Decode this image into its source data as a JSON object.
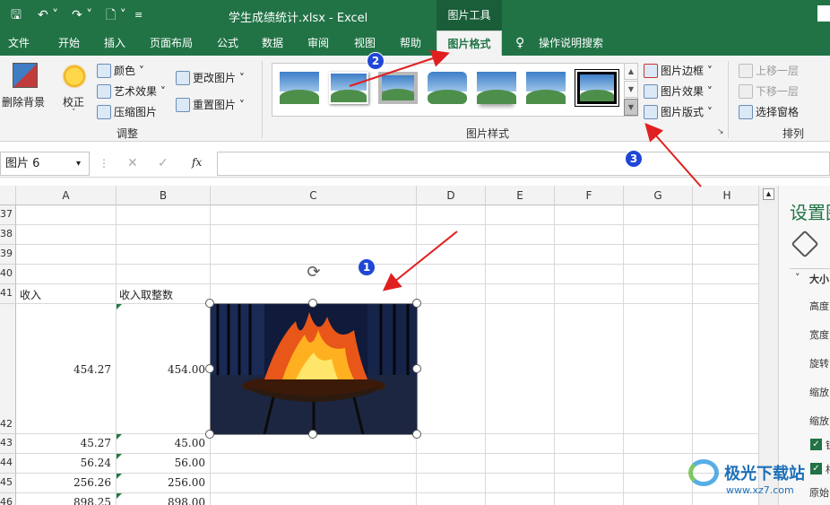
{
  "title_bar": {
    "doc_title": "学生成绩统计.xlsx  -  Excel",
    "context_tool": "图片工具",
    "qa_save": "🖫",
    "qa_undo": "↶ ˅",
    "qa_redo": "↷ ˅",
    "qa_preview": "🗋 ˅",
    "qa_more": "≡"
  },
  "menu": {
    "tabs": [
      "文件",
      "开始",
      "插入",
      "页面布局",
      "公式",
      "数据",
      "审阅",
      "视图",
      "帮助",
      "图片格式",
      "操作说明搜索"
    ],
    "active": "图片格式",
    "search_icon": "lightbulb-icon"
  },
  "ribbon": {
    "remove_bg": "删除背景",
    "corrections": "校正",
    "color": "颜色 ˅",
    "art_effects": "艺术效果 ˅",
    "compress": "压缩图片",
    "change_picture": "更改图片 ˅",
    "reset_picture": "重置图片 ˅",
    "group_adjust": "调整",
    "group_styles": "图片样式",
    "picture_border": "图片边框 ˅",
    "picture_effects": "图片效果 ˅",
    "picture_layout": "图片版式 ˅",
    "bring_forward": "上移一层",
    "send_backward": "下移一层",
    "selection_pane": "选择窗格",
    "group_arrange": "排列",
    "gallery_up": "▲",
    "gallery_down": "▼",
    "gallery_more": "▼",
    "launcher": "↘"
  },
  "formula_bar": {
    "name_box": "图片 6",
    "name_dropdown": "▾",
    "more": "⋮",
    "cancel": "✕",
    "enter": "✓",
    "fx": "fx",
    "value": ""
  },
  "columns": [
    "A",
    "B",
    "C",
    "D",
    "E",
    "F",
    "G",
    "H"
  ],
  "rows": [
    {
      "num": "37",
      "a": "",
      "b": ""
    },
    {
      "num": "38",
      "a": "",
      "b": ""
    },
    {
      "num": "39",
      "a": "",
      "b": ""
    },
    {
      "num": "40",
      "a": "",
      "b": ""
    },
    {
      "num": "41",
      "a": "收入",
      "b": "收入取整数"
    },
    {
      "num": "42",
      "a": "454.27",
      "b": "454.00"
    },
    {
      "num": "43",
      "a": "45.27",
      "b": "45.00"
    },
    {
      "num": "44",
      "a": "56.24",
      "b": "56.00"
    },
    {
      "num": "45",
      "a": "256.26",
      "b": "256.00"
    },
    {
      "num": "46",
      "a": "898.25",
      "b": "898.00"
    }
  ],
  "side_pane": {
    "title": "设置图",
    "section": "大小",
    "height": "高度",
    "width": "宽度",
    "rotation": "旋转",
    "scale_h": "缩放",
    "scale_w": "缩放",
    "lock": "锁",
    "relative": "相",
    "original": "原始"
  },
  "annotations": {
    "badge1": "1",
    "badge2": "2",
    "badge3": "3"
  },
  "picture": {
    "content": "burning fire pit at night"
  },
  "watermark": {
    "text": "极光下载站",
    "url": "www.xz7.com"
  },
  "colors": {
    "excel_green": "#217346",
    "badge_blue": "#1f46d6",
    "arrow_red": "#e02020"
  }
}
